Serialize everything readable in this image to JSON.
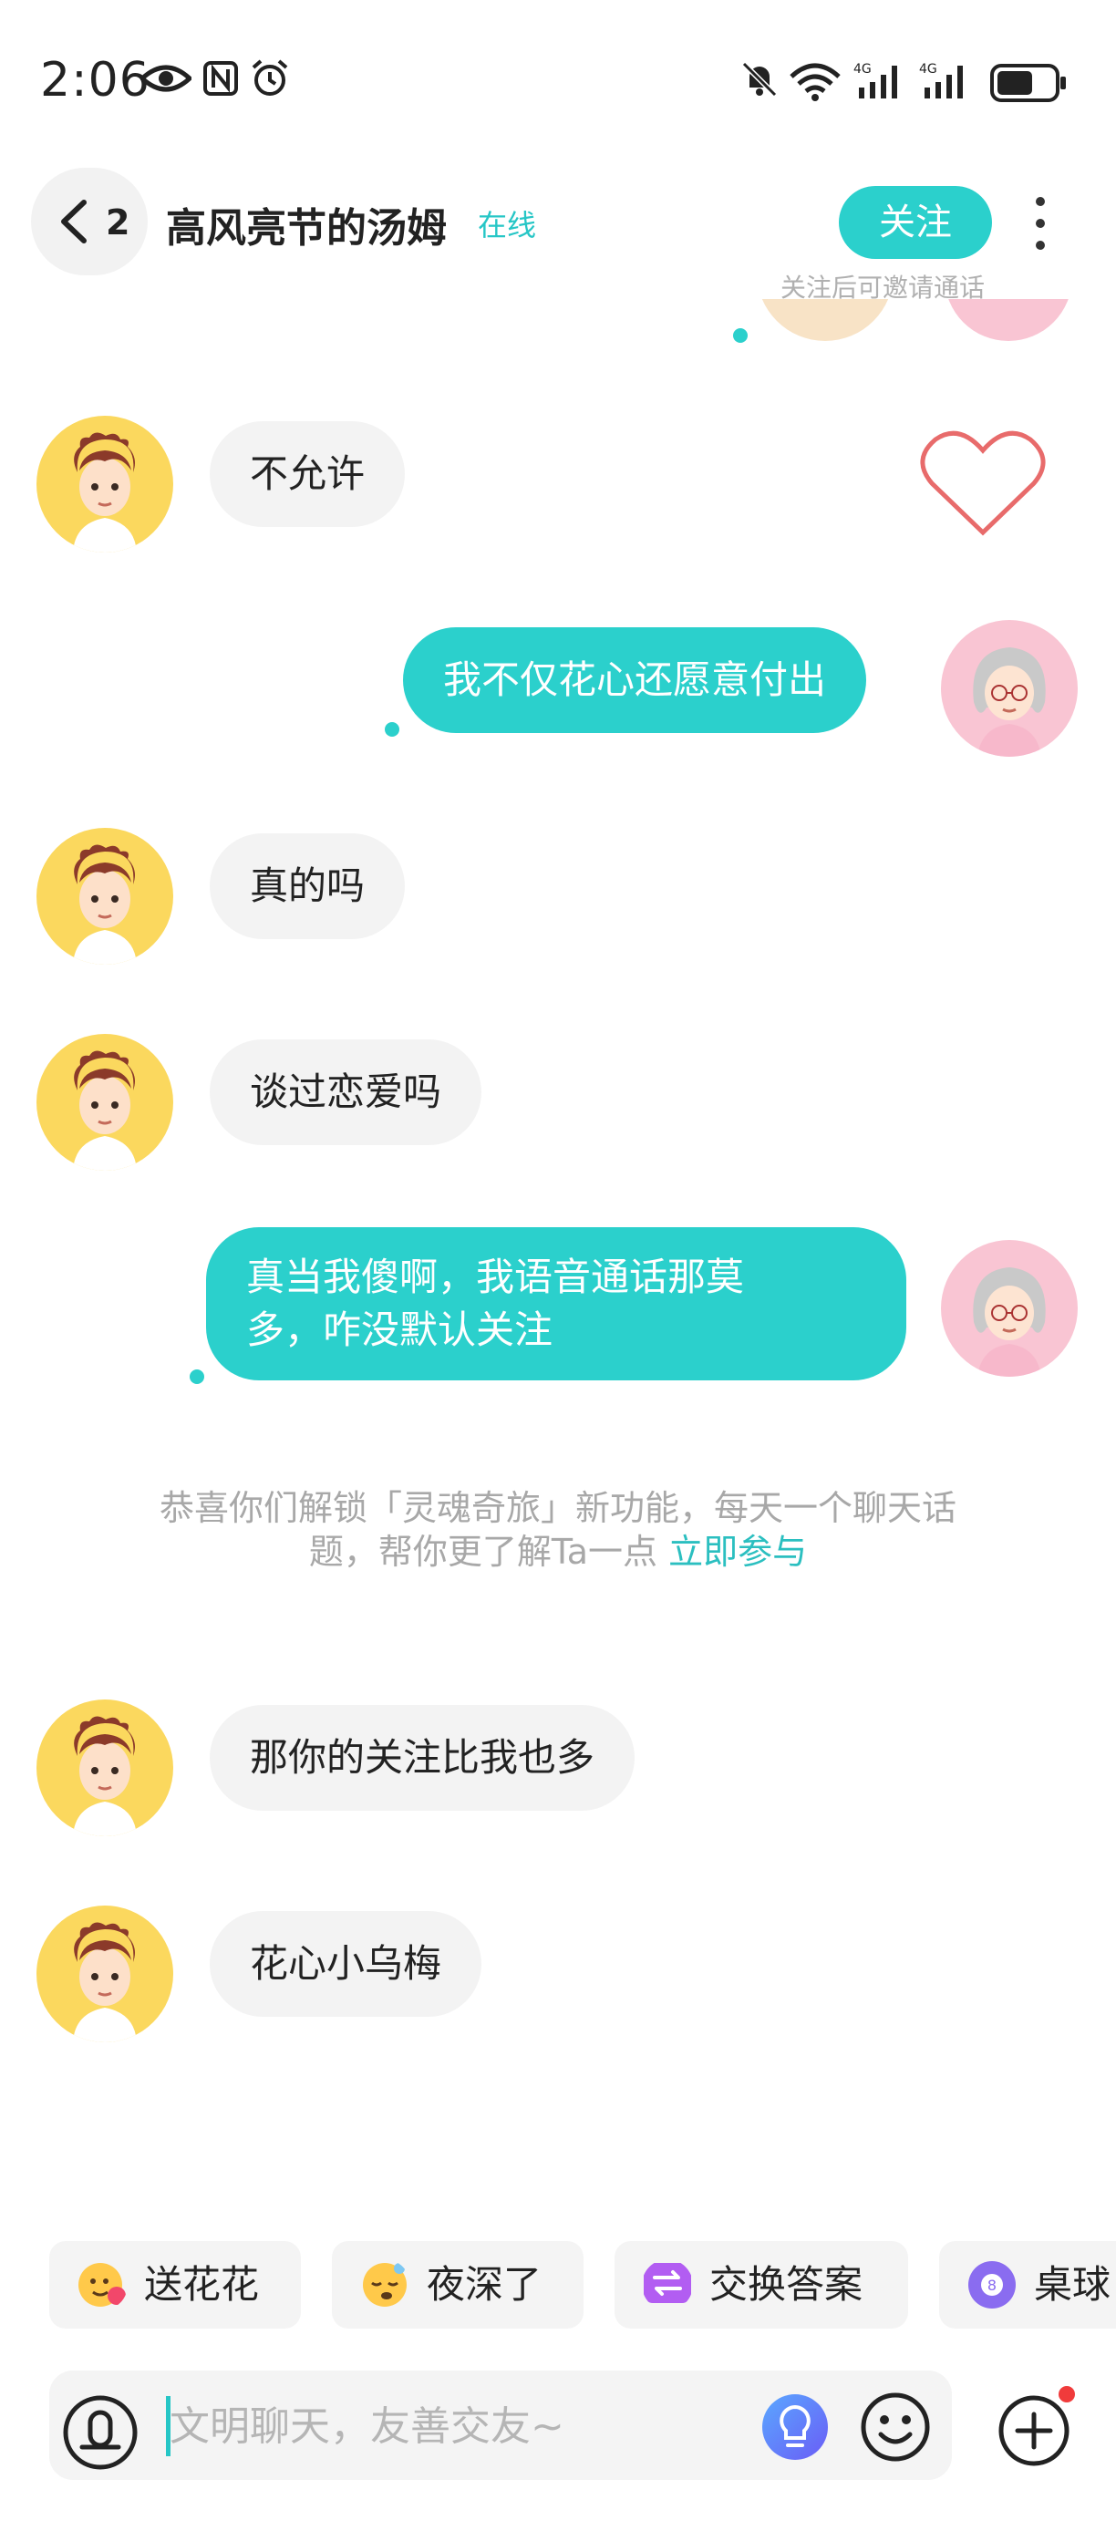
{
  "status_bar": {
    "time": "2:06",
    "icons": [
      "eye-icon",
      "nfc-icon",
      "alarm-icon",
      "mute-icon",
      "wifi-6-icon",
      "signal-4g-icon",
      "signal-4g-icon",
      "battery-icon"
    ]
  },
  "header": {
    "back_count": "2",
    "contact_name": "高风亮节的汤姆",
    "online_status": "在线",
    "follow_label": "关注",
    "follow_hint": "关注后可邀请通话"
  },
  "messages": [
    {
      "side": "in",
      "text": "不允许"
    },
    {
      "side": "out",
      "text": "我不仅花心还愿意付出"
    },
    {
      "side": "in",
      "text": "真的吗"
    },
    {
      "side": "in",
      "text": "谈过恋爱吗"
    },
    {
      "side": "out",
      "text_line1": "真当我傻啊，我语音通话那莫",
      "text_line2": "多，咋没默认关注"
    },
    {
      "side": "in",
      "text": "那你的关注比我也多"
    },
    {
      "side": "in",
      "text": "花心小乌梅"
    }
  ],
  "system_message": {
    "line1": "恭喜你们解锁「灵魂奇旅」新功能，每天一个聊天话",
    "line2": "题，帮你更了解Ta一点",
    "link": "立即参与"
  },
  "quick_actions": [
    {
      "label": "送花花",
      "icon": "flower-emoji-icon"
    },
    {
      "label": "夜深了",
      "icon": "sleepy-emoji-icon"
    },
    {
      "label": "交换答案",
      "icon": "exchange-icon"
    },
    {
      "label": "桌球",
      "icon": "billiard-ball-icon"
    }
  ],
  "input": {
    "placeholder": "文明聊天，友善交友~"
  },
  "colors": {
    "accent": "#2bd0cc",
    "bubble_in": "#f3f3f3",
    "male_avatar_bg": "#fbd85e",
    "female_avatar_bg": "#f9c5d3",
    "notification_dot": "#f03b3b"
  }
}
